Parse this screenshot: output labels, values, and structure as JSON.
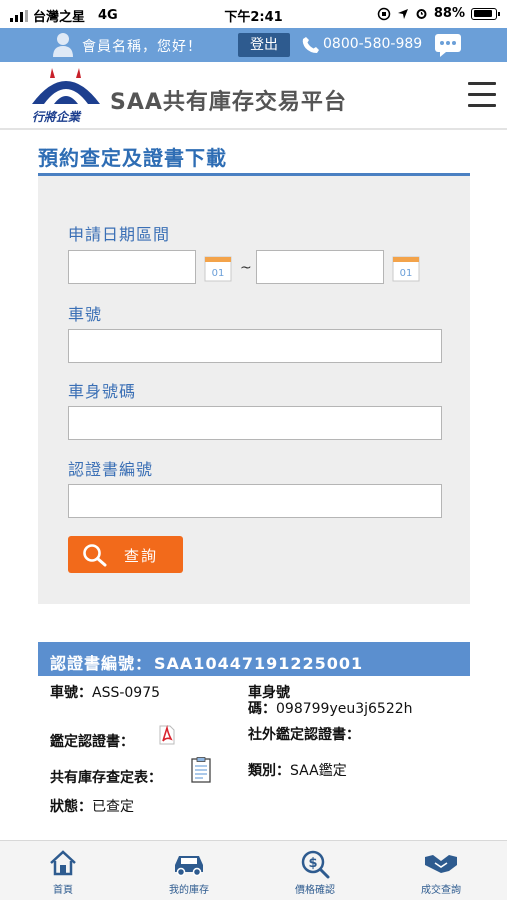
{
  "status_bar": {
    "carrier": "台灣之星",
    "network": "4G",
    "time": "下午2:41",
    "battery": "88%",
    "battery_level": 0.88
  },
  "account_bar": {
    "greeting": "會員名稱，您好！",
    "logout_label": "登出",
    "phone": "0800-580-989",
    "icons": [
      "user-icon",
      "phone-icon",
      "chat-icon"
    ]
  },
  "header": {
    "logo_text": "行將企業",
    "app_title": "SAA共有庫存交易平台",
    "menu_icon": "hamburger-icon"
  },
  "page": {
    "title": "預約查定及證書下載"
  },
  "search_form": {
    "date_range_label": "申請日期區間",
    "date_start_value": "",
    "date_separator": "~",
    "date_end_value": "",
    "calendar_icon_text": "01",
    "plate_label": "車號",
    "plate_value": "",
    "vin_label": "車身號碼",
    "vin_value": "",
    "cert_label": "認證書編號",
    "cert_value": "",
    "search_label": "查詢"
  },
  "result": {
    "cert_header_label": "認證書編號：",
    "cert_number": "SAA10447191225001",
    "plate_label": "車號：",
    "plate_value": "ASS-0975",
    "vin_label_line1": "車身號",
    "vin_label_line2": "碼：",
    "vin_value": "098799yeu3j6522h",
    "appraisal_cert_label": "鑑定認證書：",
    "external_cert_label": "社外鑑定認證書：",
    "inventory_sheet_label": "共有庫存查定表：",
    "category_label": "類別：",
    "category_value": "SAA鑑定",
    "status_label": "狀態：",
    "status_value": "已查定"
  },
  "bottom_nav": {
    "items": [
      {
        "label": "首頁",
        "icon": "home-icon"
      },
      {
        "label": "我的庫存",
        "icon": "car-icon"
      },
      {
        "label": "價格確認",
        "icon": "dollar-search-icon"
      },
      {
        "label": "成交查詢",
        "icon": "handshake-icon"
      }
    ]
  },
  "colors": {
    "accent_blue": "#6b9fd8",
    "title_blue": "#2e6db4",
    "card_header_blue": "#5b8fcf",
    "search_orange": "#f26a1b",
    "panel_gray": "#eeeeee"
  }
}
